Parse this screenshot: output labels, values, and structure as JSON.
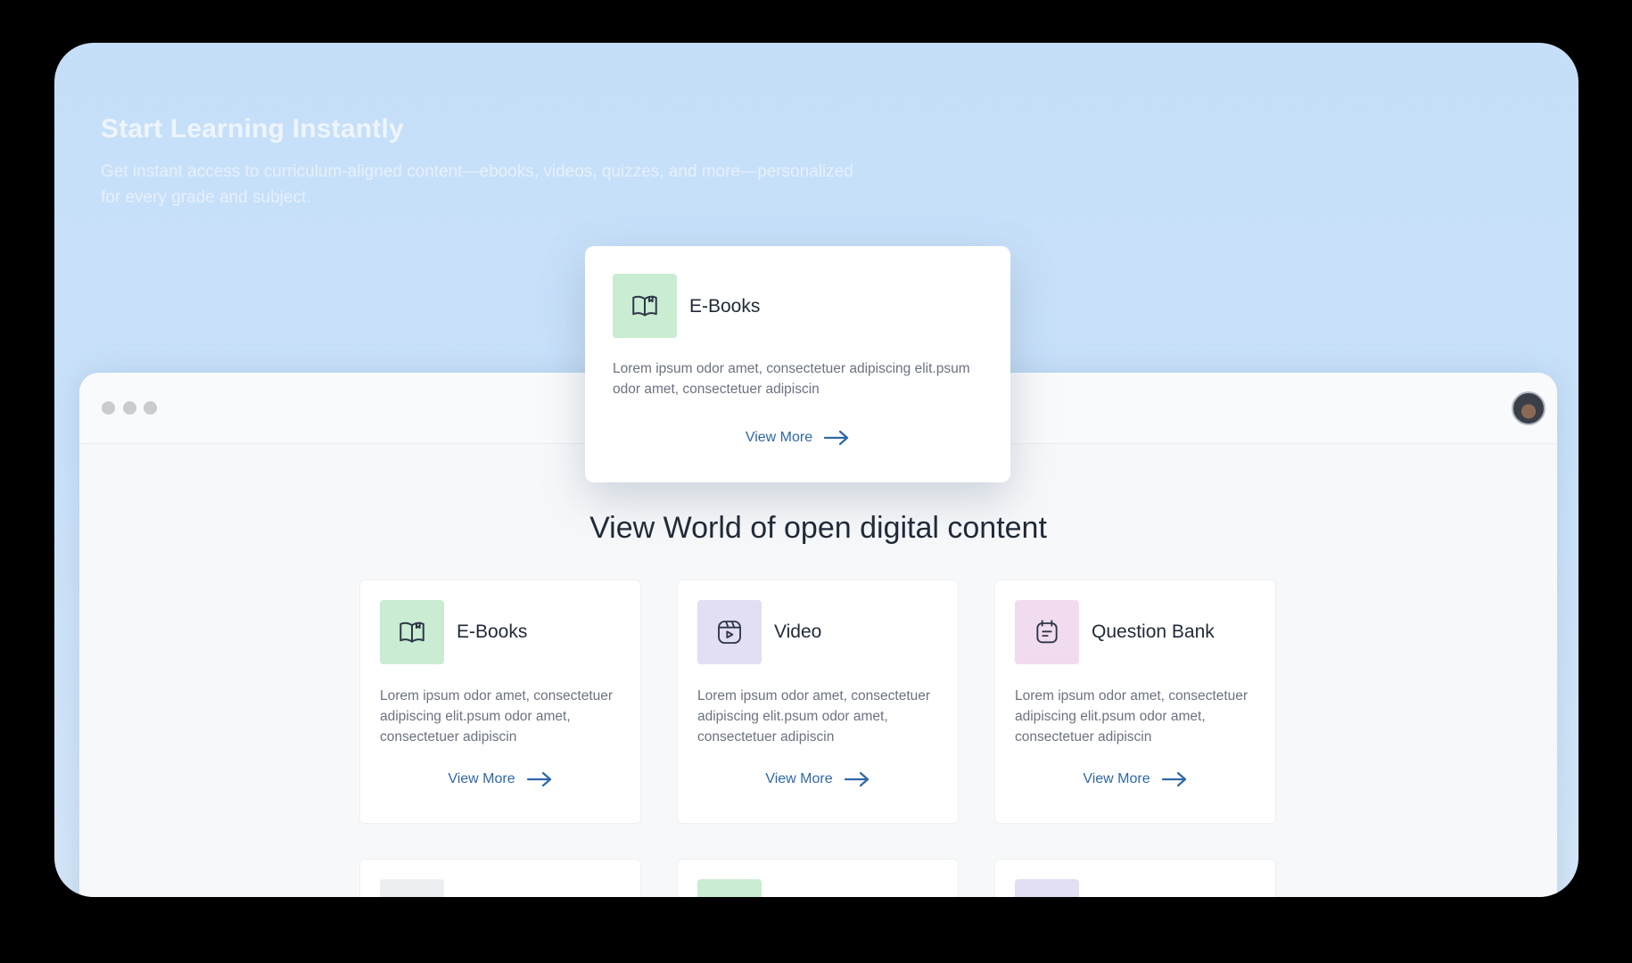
{
  "hero": {
    "title": "Start Learning Instantly",
    "subtitle": "Get instant access to curriculum-aligned content—ebooks, videos, quizzes, and more—personalized for every grade and subject."
  },
  "featured_card": {
    "icon": "book-icon",
    "title": "E-Books",
    "description": "Lorem ipsum odor amet, consectetuer adipiscing elit.psum odor amet, consectetuer adipiscin",
    "link": "View More"
  },
  "section": {
    "title": "View World of open digital content"
  },
  "cards": [
    {
      "icon": "book-icon",
      "title": "E-Books",
      "description": "Lorem ipsum odor amet, consectetuer adipiscing elit.psum odor amet, consectetuer adipiscin",
      "link": "View More",
      "color": "#c9ecd2"
    },
    {
      "icon": "video-icon",
      "title": "Video",
      "description": "Lorem ipsum odor amet, consectetuer adipiscing elit.psum odor amet, consectetuer adipiscin",
      "link": "View More",
      "color": "#e2def4"
    },
    {
      "icon": "question-bank-icon",
      "title": "Question Bank",
      "description": "Lorem ipsum odor amet, consectetuer adipiscing elit.psum odor amet, consectetuer adipiscin",
      "link": "View More",
      "color": "#f1dbee"
    }
  ],
  "colors": {
    "accent": "#2f67a8",
    "background": "#c9e1fa"
  }
}
